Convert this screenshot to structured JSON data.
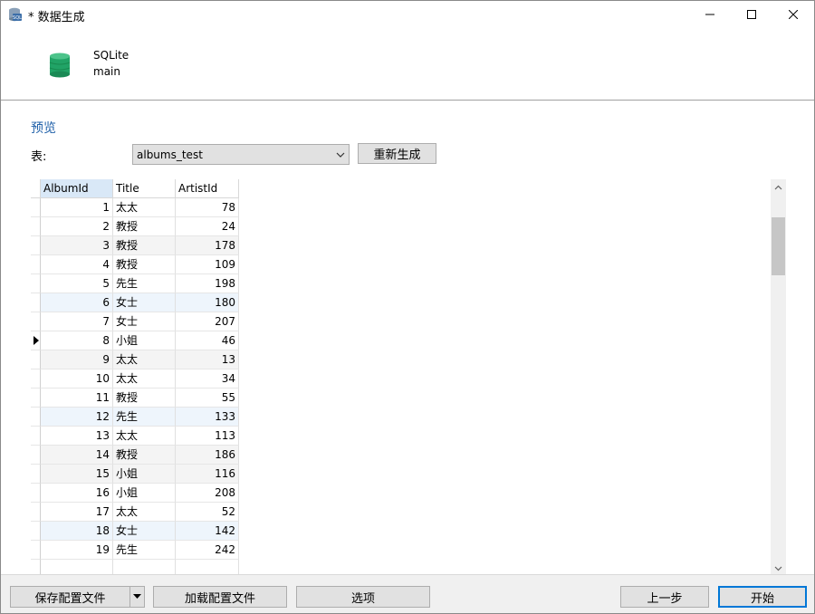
{
  "window": {
    "title": "* 数据生成",
    "icon": "database-sql-icon"
  },
  "header": {
    "connection": "SQLite",
    "database": "main",
    "icon": "database-icon",
    "icon_color": "#21a366"
  },
  "preview": {
    "section_title": "预览",
    "table_label": "表:",
    "table_selected": "albums_test",
    "regenerate_label": "重新生成"
  },
  "grid": {
    "columns": [
      "AlbumId",
      "Title",
      "ArtistId"
    ],
    "current_row": 8,
    "rows": [
      {
        "AlbumId": "1",
        "Title": "太太",
        "ArtistId": "78"
      },
      {
        "AlbumId": "2",
        "Title": "教授",
        "ArtistId": "24"
      },
      {
        "AlbumId": "3",
        "Title": "教授",
        "ArtistId": "178"
      },
      {
        "AlbumId": "4",
        "Title": "教授",
        "ArtistId": "109"
      },
      {
        "AlbumId": "5",
        "Title": "先生",
        "ArtistId": "198"
      },
      {
        "AlbumId": "6",
        "Title": "女士",
        "ArtistId": "180"
      },
      {
        "AlbumId": "7",
        "Title": "女士",
        "ArtistId": "207"
      },
      {
        "AlbumId": "8",
        "Title": "小姐",
        "ArtistId": "46"
      },
      {
        "AlbumId": "9",
        "Title": "太太",
        "ArtistId": "13"
      },
      {
        "AlbumId": "10",
        "Title": "太太",
        "ArtistId": "34"
      },
      {
        "AlbumId": "11",
        "Title": "教授",
        "ArtistId": "55"
      },
      {
        "AlbumId": "12",
        "Title": "先生",
        "ArtistId": "133"
      },
      {
        "AlbumId": "13",
        "Title": "太太",
        "ArtistId": "113"
      },
      {
        "AlbumId": "14",
        "Title": "教授",
        "ArtistId": "186"
      },
      {
        "AlbumId": "15",
        "Title": "小姐",
        "ArtistId": "116"
      },
      {
        "AlbumId": "16",
        "Title": "小姐",
        "ArtistId": "208"
      },
      {
        "AlbumId": "17",
        "Title": "太太",
        "ArtistId": "52"
      },
      {
        "AlbumId": "18",
        "Title": "女士",
        "ArtistId": "142"
      },
      {
        "AlbumId": "19",
        "Title": "先生",
        "ArtistId": "242"
      },
      {
        "AlbumId": "",
        "Title": "",
        "ArtistId": ""
      }
    ]
  },
  "footer": {
    "save_profile": "保存配置文件",
    "load_profile": "加载配置文件",
    "options": "选项",
    "back": "上一步",
    "start": "开始"
  },
  "colors": {
    "accent": "#0078d7",
    "section_title": "#1e5fa8",
    "selected_header": "#d9e8f7"
  }
}
